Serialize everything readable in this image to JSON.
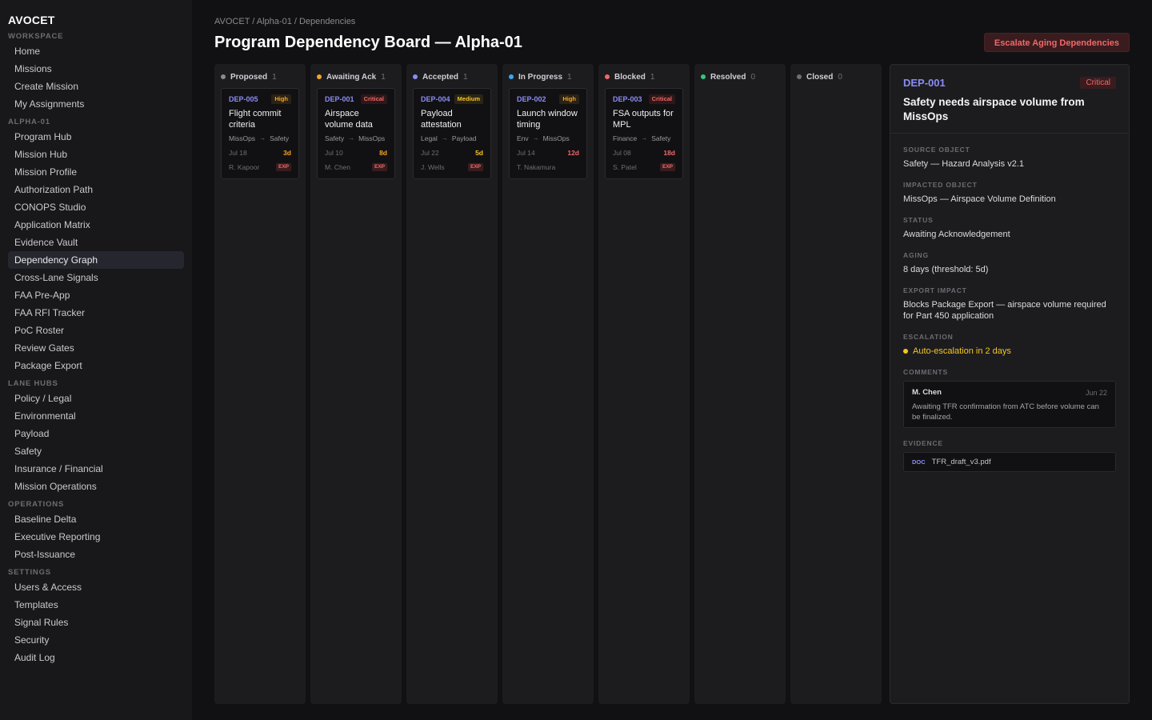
{
  "app": {
    "brand": "AVOCET"
  },
  "sidebar": {
    "sections": [
      {
        "label": "WORKSPACE",
        "items": [
          "Home",
          "Missions",
          "Create Mission",
          "My Assignments"
        ]
      },
      {
        "label": "ALPHA-01",
        "items": [
          "Program Hub",
          "Mission Hub",
          "Mission Profile",
          "Authorization Path",
          "CONOPS Studio",
          "Application Matrix",
          "Evidence Vault",
          "Dependency Graph",
          "Cross-Lane Signals",
          "FAA Pre-App",
          "FAA RFI Tracker",
          "PoC Roster",
          "Review Gates",
          "Package Export"
        ]
      },
      {
        "label": "LANE HUBS",
        "items": [
          "Policy / Legal",
          "Environmental",
          "Payload",
          "Safety",
          "Insurance / Financial",
          "Mission Operations"
        ]
      },
      {
        "label": "OPERATIONS",
        "items": [
          "Baseline Delta",
          "Executive Reporting",
          "Post-Issuance"
        ]
      },
      {
        "label": "SETTINGS",
        "items": [
          "Users & Access",
          "Templates",
          "Signal Rules",
          "Security",
          "Audit Log"
        ]
      }
    ],
    "active": "Dependency Graph"
  },
  "header": {
    "breadcrumb": "AVOCET / Alpha-01 / Dependencies",
    "title": "Program Dependency Board — Alpha-01",
    "escalate_label": "Escalate Aging Dependencies"
  },
  "columns": [
    {
      "name": "Proposed",
      "count": "1",
      "color": "#8a8a90",
      "card": {
        "id": "DEP-005",
        "priority": "High",
        "priority_level": "high",
        "title": "Flight commit criteria",
        "from": "MissOps",
        "to": "Safety",
        "date": "Jul 18",
        "age": "3d",
        "age_level": "warn",
        "owner": "R. Kapoor",
        "tag": "EXP"
      }
    },
    {
      "name": "Awaiting Ack",
      "count": "1",
      "color": "#f5a524",
      "card": {
        "id": "DEP-001",
        "priority": "Critical",
        "priority_level": "critical",
        "title": "Airspace volume data",
        "from": "Safety",
        "to": "MissOps",
        "date": "Jul 10",
        "age": "8d",
        "age_level": "warn",
        "owner": "M. Chen",
        "tag": "EXP"
      }
    },
    {
      "name": "Accepted",
      "count": "1",
      "color": "#8b8cf6",
      "card": {
        "id": "DEP-004",
        "priority": "Medium",
        "priority_level": "medium",
        "title": "Payload attestation",
        "from": "Legal",
        "to": "Payload",
        "date": "Jul 22",
        "age": "5d",
        "age_level": "med",
        "owner": "J. Wells",
        "tag": "EXP"
      }
    },
    {
      "name": "In Progress",
      "count": "1",
      "color": "#3ba7f0",
      "card": {
        "id": "DEP-002",
        "priority": "High",
        "priority_level": "high",
        "title": "Launch window timing",
        "from": "Env",
        "to": "MissOps",
        "date": "Jul 14",
        "age": "12d",
        "age_level": "crit",
        "owner": "T. Nakamura",
        "tag": ""
      }
    },
    {
      "name": "Blocked",
      "count": "1",
      "color": "#f0686a",
      "card": {
        "id": "DEP-003",
        "priority": "Critical",
        "priority_level": "critical",
        "title": "FSA outputs for MPL",
        "from": "Finance",
        "to": "Safety",
        "date": "Jul 08",
        "age": "18d",
        "age_level": "crit",
        "owner": "S. Patel",
        "tag": "EXP"
      }
    },
    {
      "name": "Resolved",
      "count": "0",
      "color": "#34c77b",
      "card": null
    },
    {
      "name": "Closed",
      "count": "0",
      "color": "#6e6e74",
      "card": null
    }
  ],
  "detail": {
    "id": "DEP-001",
    "severity": "Critical",
    "title": "Safety needs airspace volume from MissOps",
    "fields": [
      {
        "label": "SOURCE OBJECT",
        "value": "Safety — Hazard Analysis v2.1"
      },
      {
        "label": "IMPACTED OBJECT",
        "value": "MissOps — Airspace Volume Definition"
      },
      {
        "label": "STATUS",
        "value": "Awaiting Acknowledgement"
      },
      {
        "label": "AGING",
        "value": "8 days (threshold: 5d)"
      },
      {
        "label": "EXPORT IMPACT",
        "value": "Blocks Package Export — airspace volume required for Part 450 application"
      }
    ],
    "escalation_label": "ESCALATION",
    "escalation_value": "Auto-escalation in 2 days",
    "comments_label": "COMMENTS",
    "comment": {
      "author": "M. Chen",
      "date": "Jun 22",
      "text": "Awaiting TFR confirmation from ATC before volume can be finalized."
    },
    "evidence_label": "EVIDENCE",
    "evidence": {
      "type": "DOC",
      "name": "TFR_draft_v3.pdf"
    }
  }
}
